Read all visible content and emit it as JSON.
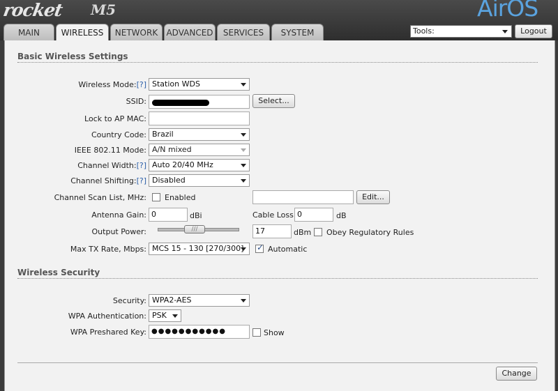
{
  "brand": {
    "product": "rocket",
    "model": "M5",
    "logo": "AirOS"
  },
  "tabs": [
    "MAIN",
    "WIRELESS",
    "NETWORK",
    "ADVANCED",
    "SERVICES",
    "SYSTEM"
  ],
  "tools": {
    "label": "Tools:"
  },
  "logout_label": "Logout",
  "basic": {
    "title": "Basic Wireless Settings",
    "help": "[?]",
    "wireless_mode": {
      "label": "Wireless Mode:",
      "value": "Station WDS"
    },
    "ssid": {
      "label": "SSID:",
      "select_label": "Select..."
    },
    "lock_ap": {
      "label": "Lock to AP MAC:",
      "value": ""
    },
    "country": {
      "label": "Country Code:",
      "value": "Brazil"
    },
    "ieee": {
      "label": "IEEE 802.11 Mode:",
      "value": "A/N mixed"
    },
    "channel_width": {
      "label": "Channel Width:",
      "value": "Auto 20/40 MHz"
    },
    "channel_shifting": {
      "label": "Channel Shifting:",
      "value": "Disabled"
    },
    "scan_list": {
      "label": "Channel Scan List, MHz:",
      "enabled_label": "Enabled",
      "edit_label": "Edit..."
    },
    "antenna_gain": {
      "label": "Antenna Gain:",
      "value": "0",
      "unit": "dBi"
    },
    "cable_loss": {
      "label": "Cable Loss:",
      "value": "0",
      "unit": "dB"
    },
    "output_power": {
      "label": "Output Power:",
      "value": "17",
      "unit": "dBm",
      "obey_label": "Obey Regulatory Rules",
      "slider_grip": "///"
    },
    "max_tx": {
      "label": "Max TX Rate, Mbps:",
      "value": "MCS 15 - 130 [270/300]",
      "auto_label": "Automatic"
    }
  },
  "security": {
    "title": "Wireless Security",
    "security": {
      "label": "Security:",
      "value": "WPA2-AES"
    },
    "wpa_auth": {
      "label": "WPA Authentication:",
      "value": "PSK"
    },
    "psk": {
      "label": "WPA Preshared Key:",
      "value": "●●●●●●●●●●●",
      "show_label": "Show"
    }
  },
  "change_label": "Change"
}
